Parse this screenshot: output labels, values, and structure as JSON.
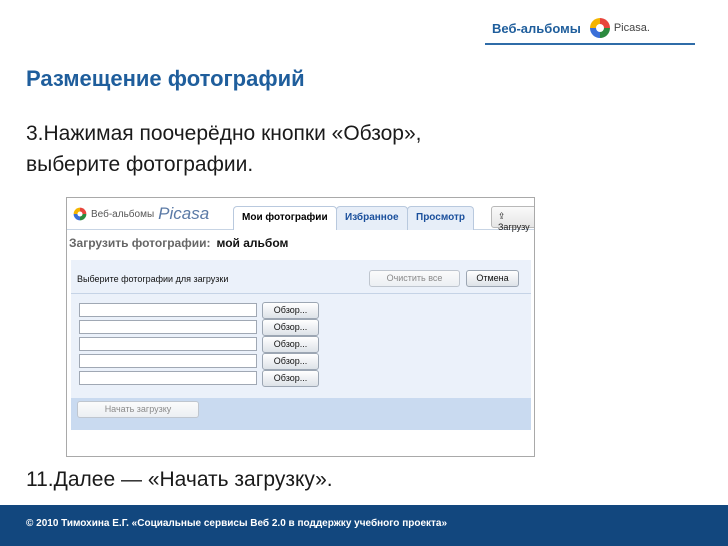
{
  "header": {
    "brand": "Веб-альбомы",
    "picasa_logo_text": "Picasa."
  },
  "slide": {
    "title": "Размещение фотографий",
    "step_text_line1": "3.Нажимая поочерёдно кнопки «Обзор»,",
    "step_text_line2": "выберите фотографии.",
    "step_bottom": "11.Далее — «Начать загрузку»."
  },
  "screenshot": {
    "logo_small": "Веб-альбомы",
    "logo_big": "Picasa",
    "tabs": [
      {
        "label": "Мои фотографии",
        "active": true
      },
      {
        "label": "Избранное",
        "active": false
      },
      {
        "label": "Просмотр",
        "active": false
      }
    ],
    "upload_button": "Загрузу",
    "heading_label": "Загрузить фотографии:",
    "album_name": "мой альбом",
    "panel_title": "Выберите фотографии для загрузки",
    "clear_all_button": "Очистить все",
    "cancel_button": "Отмена",
    "browse_buttons": [
      "Обзор...",
      "Обзор...",
      "Обзор...",
      "Обзор...",
      "Обзор..."
    ],
    "file_fields": [
      "",
      "",
      "",
      "",
      ""
    ],
    "start_upload_button": "Начать загрузку"
  },
  "footer": {
    "text": "© 2010  Тимохина Е.Г.  «Социальные сервисы Веб 2.0 в поддержку  учебного проекта»"
  },
  "colors": {
    "accent_blue": "#1f5e9c",
    "footer_bg": "#12477e",
    "panel_bg": "#ebf1fa"
  }
}
